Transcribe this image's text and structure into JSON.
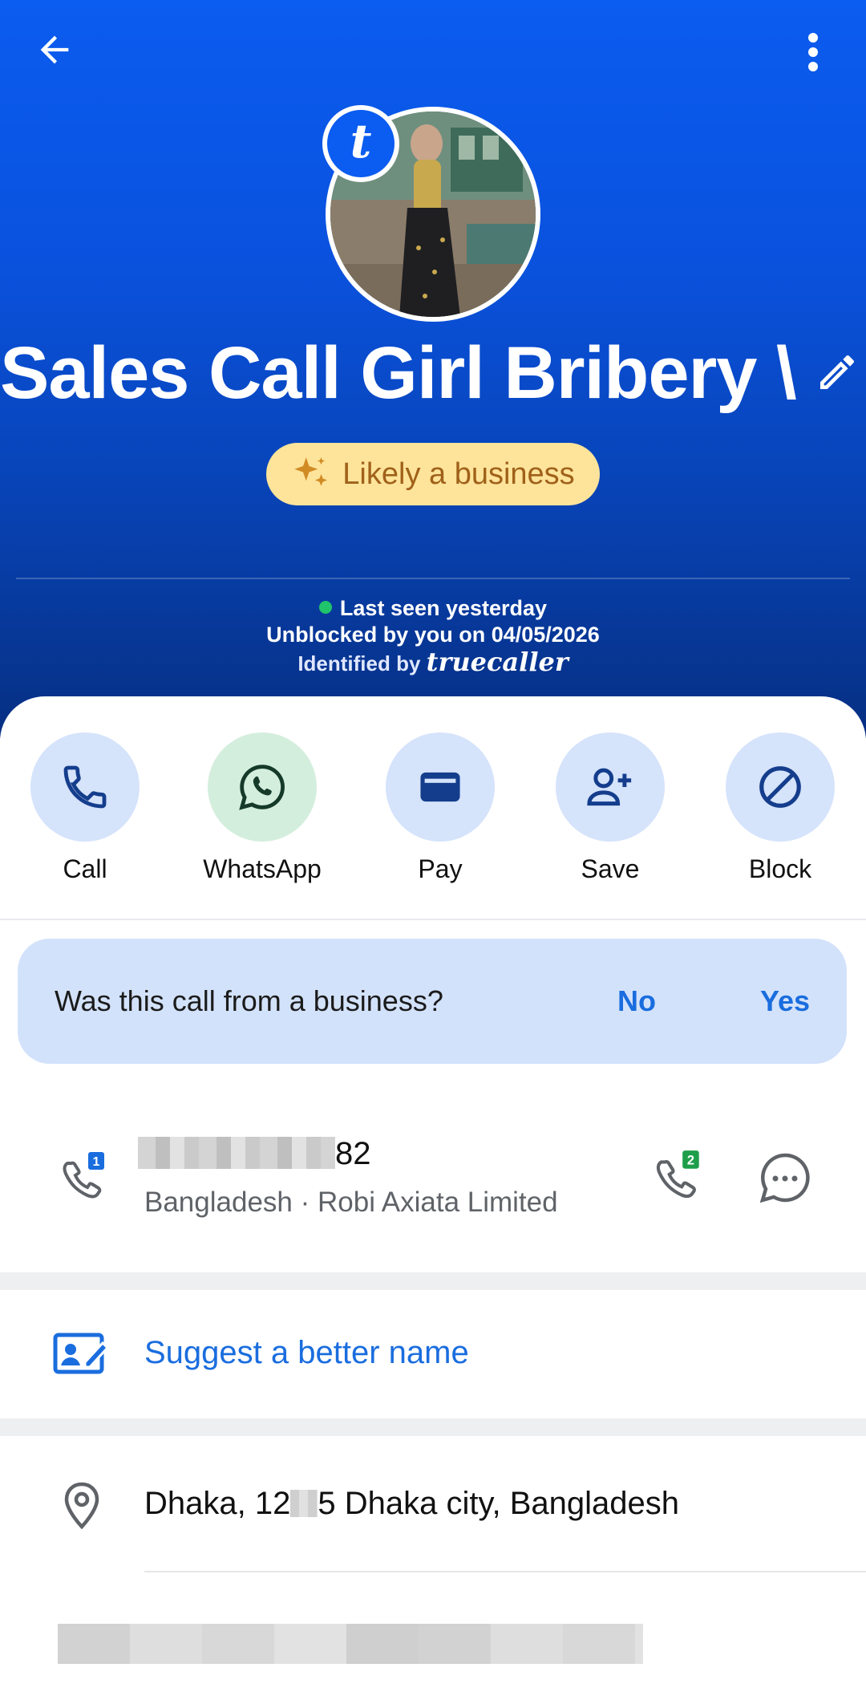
{
  "header": {
    "back_icon": "arrow-left-icon",
    "more_icon": "more-vert-icon",
    "contact_name": "Sales Call Girl Bribery \\",
    "edit_icon": "pencil-icon",
    "avatar_badge": "t",
    "business_pill": "Likely a business",
    "last_seen": "Last seen yesterday",
    "unblocked": "Unblocked by you on 04/05/2026",
    "identified_prefix": "Identified by",
    "identified_brand": "truecaller"
  },
  "actions": [
    {
      "label": "Call",
      "icon": "phone-icon"
    },
    {
      "label": "WhatsApp",
      "icon": "whatsapp-icon"
    },
    {
      "label": "Pay",
      "icon": "wallet-icon"
    },
    {
      "label": "Save",
      "icon": "add-person-icon"
    },
    {
      "label": "Block",
      "icon": "block-icon"
    }
  ],
  "business_question": {
    "question": "Was this call from a business?",
    "no": "No",
    "yes": "Yes"
  },
  "number": {
    "suffix": "82",
    "sim1_badge": "1",
    "sim2_badge": "2",
    "carrier": "Bangladesh · Robi Axiata Limited"
  },
  "suggest": {
    "label": "Suggest a better name"
  },
  "address": {
    "prefix": "Dhaka, 12",
    "suffix": "5 Dhaka city, Bangladesh"
  },
  "colors": {
    "header_blue": "#0b5cf0",
    "action_circle": "#d5e3fb",
    "whatsapp_circle": "#d4eedd",
    "accent_blue": "#1a6dde",
    "pill_yellow": "#fde49a"
  }
}
